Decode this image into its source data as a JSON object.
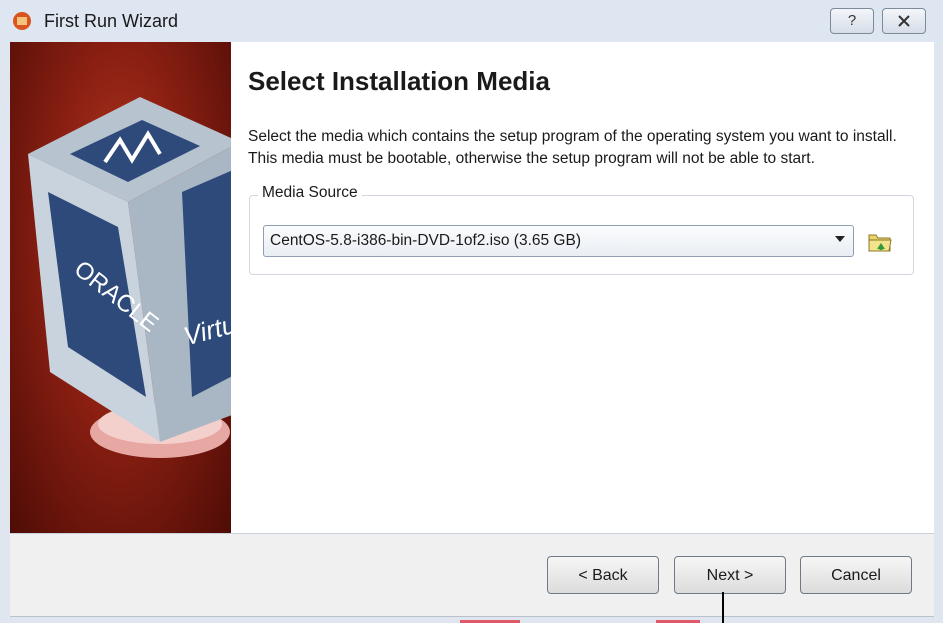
{
  "window": {
    "title": "First Run Wizard",
    "help_label": "?",
    "close_label": "X"
  },
  "banner": {
    "brand_text": "ORACLE",
    "product_text": "Virtu"
  },
  "page": {
    "title": "Select Installation Media",
    "description": "Select the media which contains the setup program of the operating system you want to install. This media must be bootable, otherwise the setup program will not be able to start."
  },
  "media_source": {
    "label": "Media Source",
    "selected": "CentOS-5.8-i386-bin-DVD-1of2.iso (3.65 GB)"
  },
  "buttons": {
    "back": "< Back",
    "next": "Next >",
    "cancel": "Cancel"
  },
  "colors": {
    "banner_red": "#8a1f12",
    "cube_blue": "#2d4a7a"
  }
}
